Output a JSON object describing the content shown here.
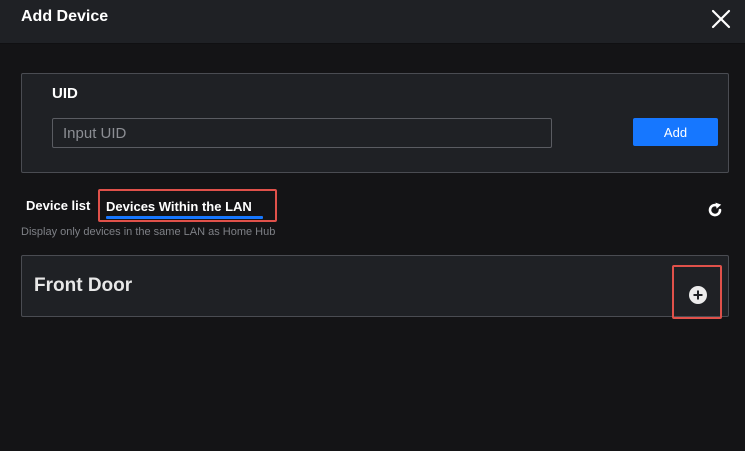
{
  "dialog": {
    "title": "Add Device"
  },
  "uid": {
    "label": "UID",
    "placeholder": "Input UID",
    "value": "",
    "add_label": "Add"
  },
  "tabs": [
    {
      "label": "Device list",
      "active": false
    },
    {
      "label": "Devices Within the LAN",
      "active": true
    }
  ],
  "hint": "Display only devices in the same LAN as Home Hub",
  "devices": [
    {
      "name": "Front Door"
    }
  ],
  "icons": {
    "close": "close-icon",
    "refresh": "refresh-icon",
    "add_device": "plus-circle-icon"
  },
  "colors": {
    "accent": "#1677ff",
    "highlight": "#e0514a",
    "background": "#141416",
    "panel": "#1f2125"
  }
}
